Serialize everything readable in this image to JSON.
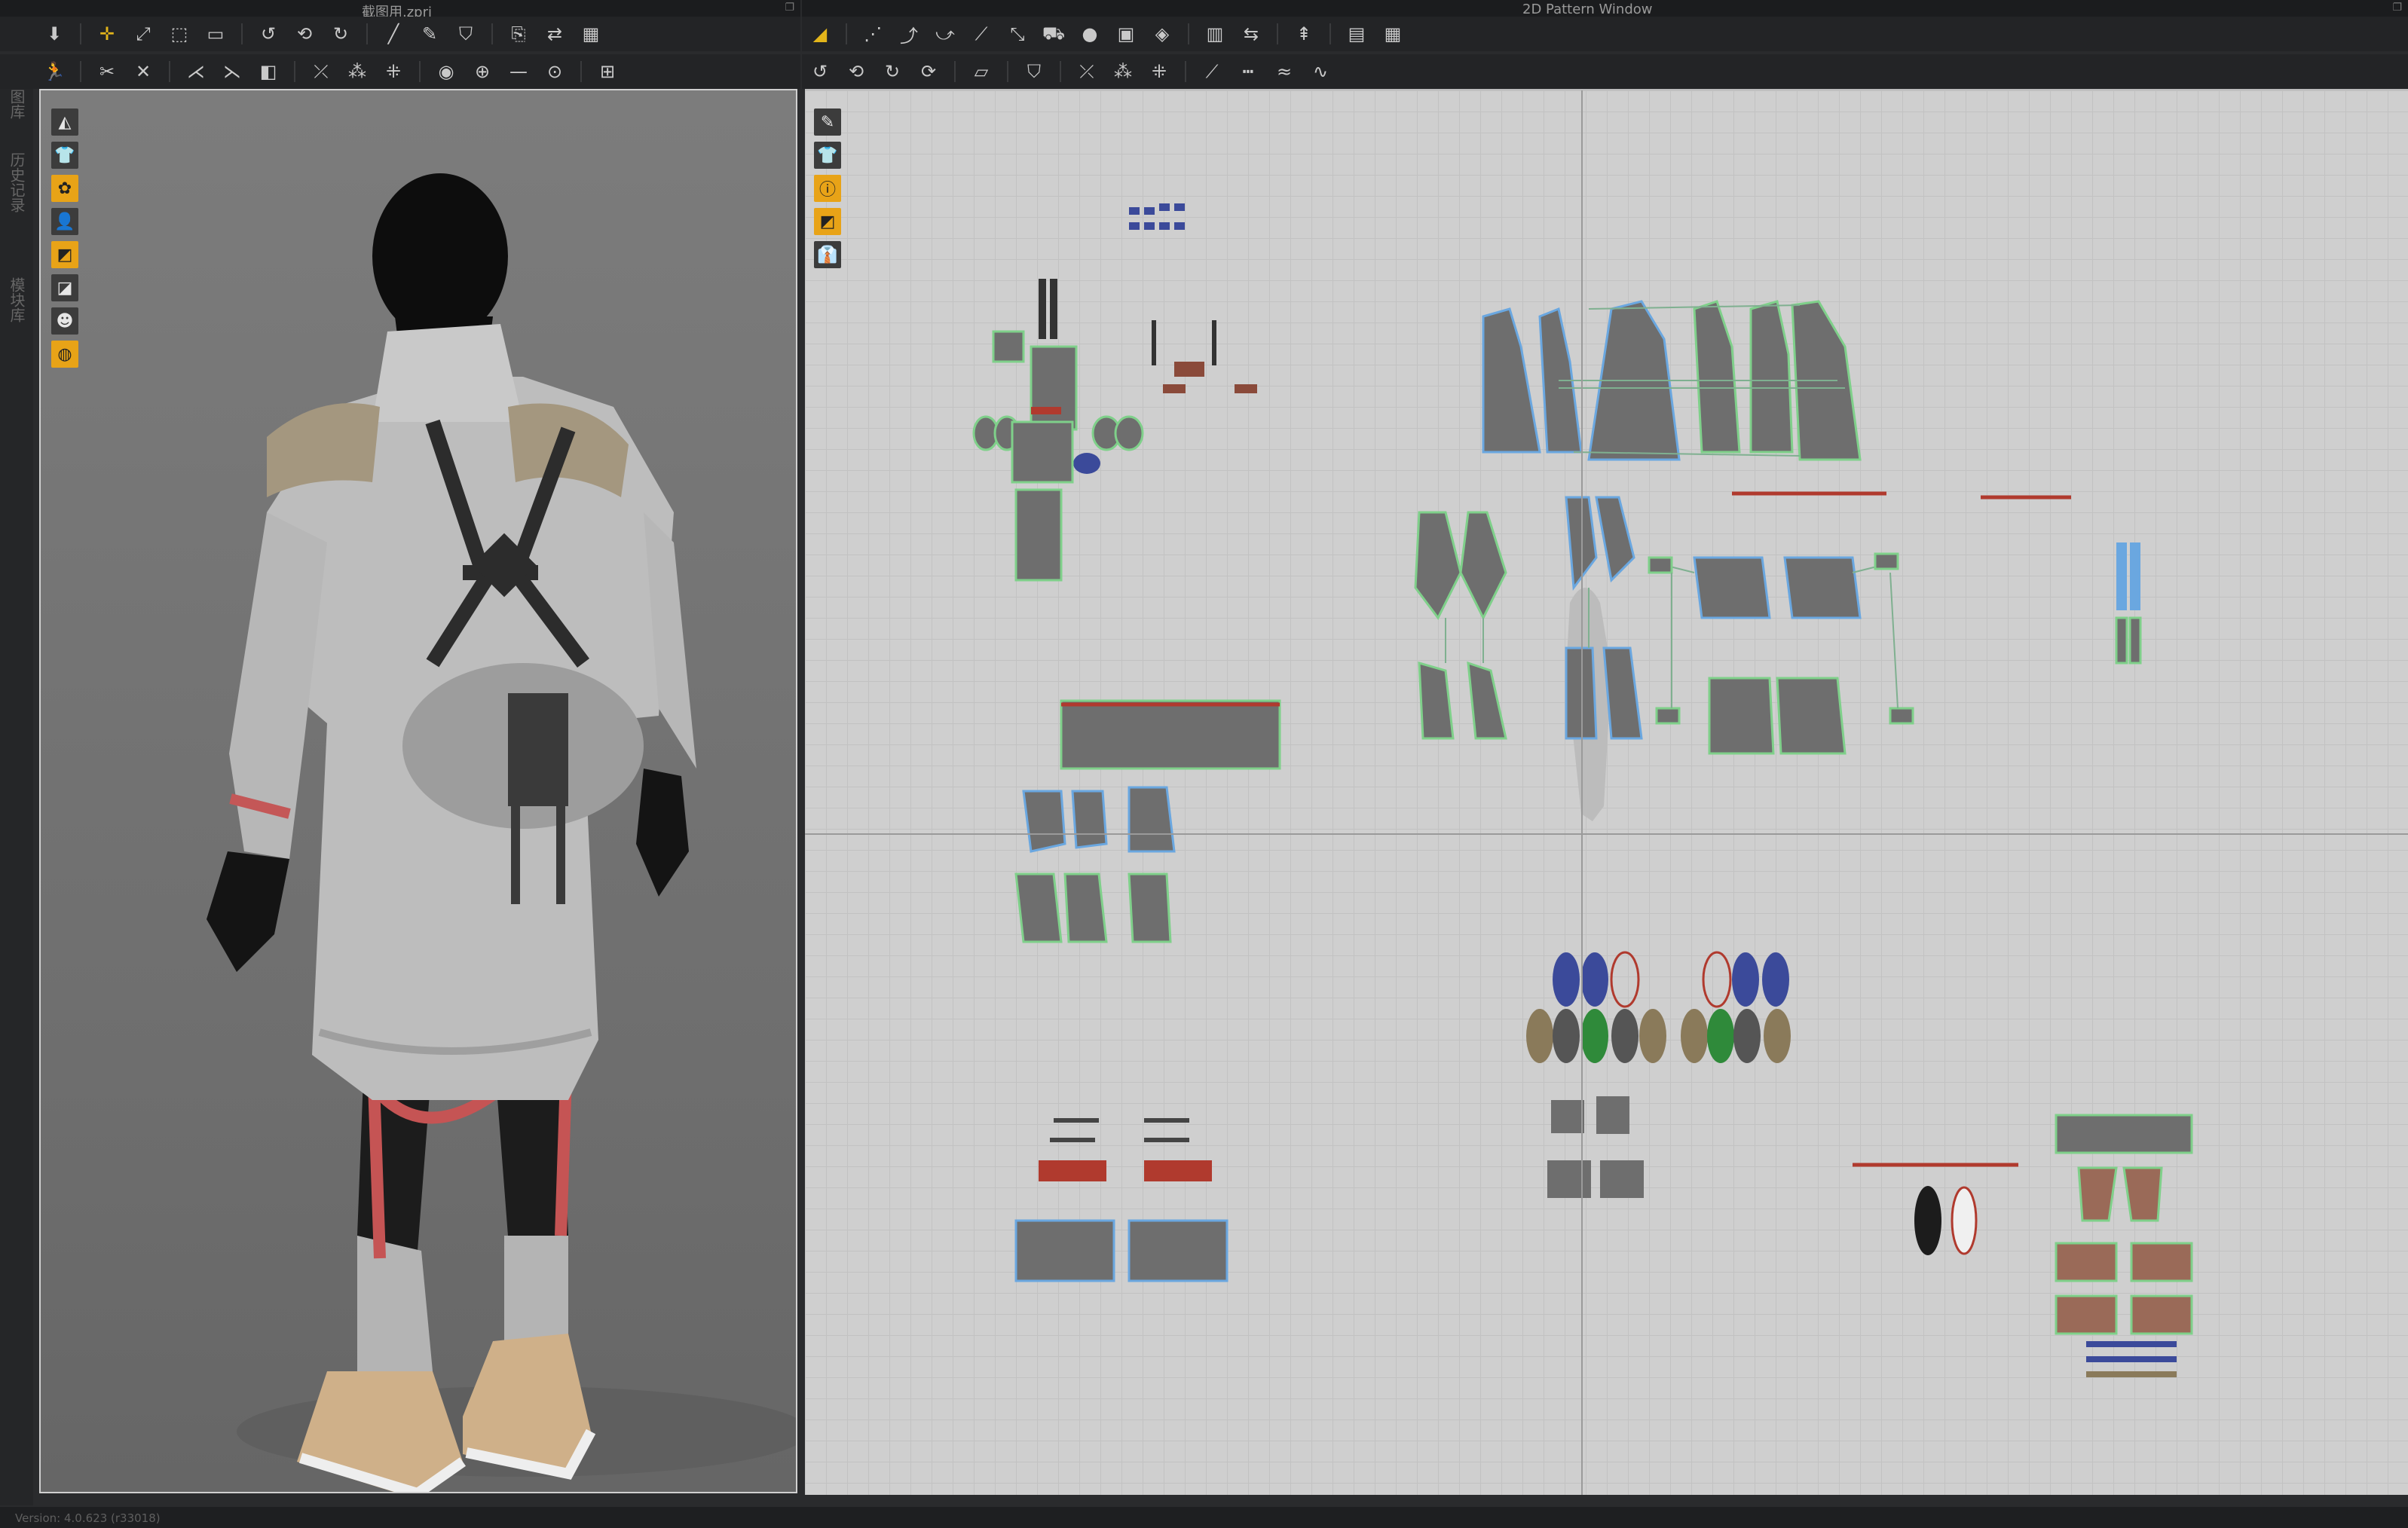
{
  "left_window": {
    "title": "截图用.zprj",
    "float_icon": "restore-icon"
  },
  "right_window": {
    "title": "2D Pattern Window",
    "float_icon": "restore-icon"
  },
  "dock": {
    "tabs": [
      "图库",
      "历史记录",
      "模块库"
    ]
  },
  "toolbar_3d_row1": [
    "select-move-icon",
    "transform-icon",
    "add-point-icon",
    "fold-arrange-icon",
    "box-select-icon",
    "sew-icon",
    "free-sew-icon",
    "pin-icon",
    "tack-icon",
    "brush-icon",
    "measure-icon",
    "snapshot-icon"
  ],
  "toolbar_3d_row2": [
    "avatar-pose-icon",
    "fabric-simulate-icon",
    "strengthen-icon",
    "cut-icon",
    "shirring-icon",
    "shape-icon",
    "button-icon",
    "buttonhole-icon",
    "topstitch-icon",
    "zipper-icon",
    "line-icon",
    "puckering-icon",
    "piping-icon"
  ],
  "toolbar_2d_row1": [
    "transform-pattern-icon",
    "edit-point-icon",
    "curve-point-icon",
    "add-point-2d-icon",
    "internal-line-icon",
    "polygon-icon",
    "rectangle-icon",
    "ellipse-icon",
    "internal-polygon-icon",
    "dart-icon",
    "trace-icon",
    "grain-icon",
    "seam-allowance-icon",
    "grid-icon"
  ],
  "toolbar_2d_row2": [
    "segment-sew-icon",
    "free-sew-2d-icon",
    "check-sew-icon",
    "elastic-icon",
    "tuck-icon",
    "fold-icon",
    "symmetry-icon",
    "pleat-icon",
    "unfold-icon",
    "texture-icon",
    "dashed-line-icon",
    "zigzag-icon"
  ],
  "view_tools_3d": [
    "avatar-display-icon",
    "garment-display-icon",
    "fabric-render-icon",
    "avatar-skin-icon",
    "texture-mode-icon",
    "shading-icon",
    "xray-icon",
    "render-sphere-icon"
  ],
  "view_tools_2d": [
    "pattern-display-icon",
    "pattern-shape-icon",
    "info-icon",
    "fill-mode-icon",
    "garment-thumb-icon"
  ],
  "colors": {
    "accent": "#e8a317",
    "pattern_fill": "#6e6e6e",
    "pattern_outline_blue": "#6aa7e0",
    "pattern_outline_green": "#7fd08a",
    "seam_red": "#c0392b",
    "canvas_bg": "#cfcfcf",
    "viewport_bg": "#737373"
  },
  "status": {
    "version": "Version: 4.0.623 (r33018)"
  }
}
